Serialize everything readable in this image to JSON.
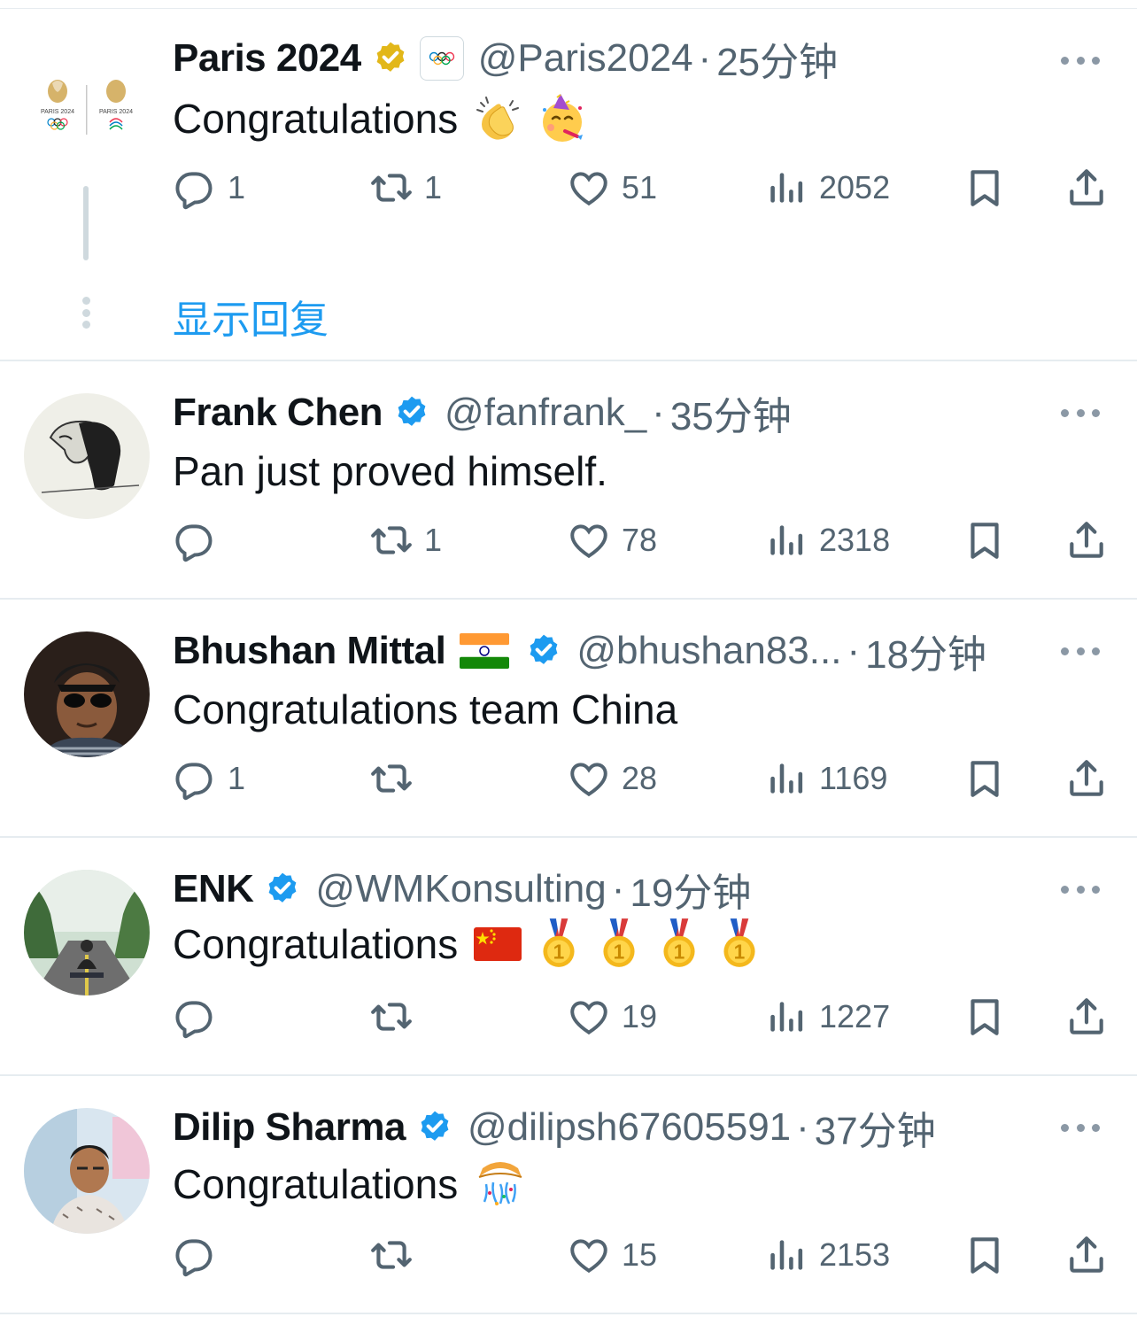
{
  "tweets": [
    {
      "name": "Paris 2024",
      "handle": "@Paris2024",
      "dot": "·",
      "time": "25分钟",
      "text": "Congratulations",
      "emojis": [
        "clapping-hands",
        "partying-face"
      ],
      "badge": "gold",
      "stats": {
        "reply": "1",
        "retweet": "1",
        "like": "51",
        "views": "2052"
      },
      "show_replies": "显示回复",
      "logo_text": "PARIS 2024"
    },
    {
      "name": "Frank Chen",
      "handle": "@fanfrank_",
      "dot": "·",
      "time": "35分钟",
      "text": "Pan just proved himself.",
      "badge": "blue",
      "stats": {
        "reply": "",
        "retweet": "1",
        "like": "78",
        "views": "2318"
      }
    },
    {
      "name": "Bhushan Mittal",
      "handle": "@bhushan83...",
      "dot": "·",
      "time": "18分钟",
      "text": "Congratulations team China",
      "badge": "blue",
      "name_flag": "india-flag",
      "stats": {
        "reply": "1",
        "retweet": "",
        "like": "28",
        "views": "1169"
      }
    },
    {
      "name": "ENK",
      "handle": "@WMKonsulting",
      "dot": "·",
      "time": "19分钟",
      "text": "Congratulations",
      "emojis": [
        "china-flag",
        "gold-medal",
        "gold-medal",
        "gold-medal",
        "gold-medal"
      ],
      "badge": "blue",
      "stats": {
        "reply": "",
        "retweet": "",
        "like": "19",
        "views": "1227"
      }
    },
    {
      "name": "Dilip Sharma",
      "handle": "@dilipsh67605591",
      "dot": "·",
      "time": "37分钟",
      "text": "Congratulations",
      "emojis": [
        "confetti-ball"
      ],
      "badge": "blue",
      "stats": {
        "reply": "",
        "retweet": "",
        "like": "15",
        "views": "2153"
      }
    }
  ],
  "colors": {
    "accent": "#1d9bf0",
    "text": "#0f1419",
    "secondary": "#536471",
    "gold_badge": "#e2b719",
    "blue_badge": "#1d9bf0"
  }
}
